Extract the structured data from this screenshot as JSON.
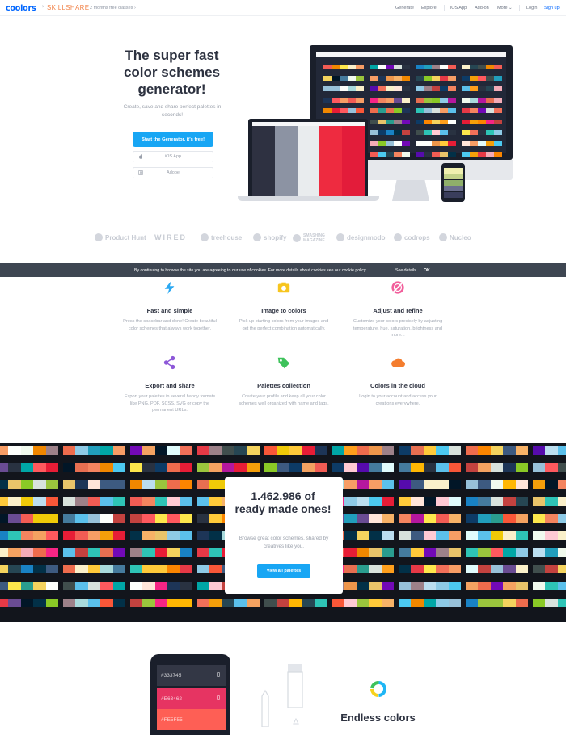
{
  "header": {
    "logo": "coolors",
    "partner_sep": "×",
    "partner": "SKILLSHARE",
    "promo": "2 months free classes ›",
    "nav": [
      "Generate",
      "Explore",
      "iOS App",
      "Add-on",
      "More ⌄",
      "Login",
      "Sign up"
    ]
  },
  "hero": {
    "title": "The super fast color schemes generator!",
    "subtitle": "Create, save and share perfect palettes in seconds!",
    "cta": "Start the Generator, it's free!",
    "ios": "iOS App",
    "adobe": "Adobe"
  },
  "brands": [
    "Product Hunt",
    "WIRED",
    "treehouse",
    "shopify",
    "SMASHING MAGAZINE",
    "designmodo",
    "codrops",
    "Nucleo"
  ],
  "cookie": {
    "text": "By continuing to browse the site you are agreeing to our use of cookies. For more details about cookies see our cookie policy.",
    "see": "See details",
    "ok": "OK"
  },
  "features": [
    {
      "title": "Fast and simple",
      "desc": "Press the spacebar and done! Create beautiful color schemes that always work together."
    },
    {
      "title": "Image to colors",
      "desc": "Pick up starting colors from your images and get the perfect combination automatically."
    },
    {
      "title": "Adjust and refine",
      "desc": "Customize your colors precisely by adjusting temperature, hue, saturation, brightness and more..."
    },
    {
      "title": "Export and share",
      "desc": "Export your palettes in several handy formats like PNG, PDF, SCSS, SVG or copy the permanent URLs."
    },
    {
      "title": "Palettes collection",
      "desc": "Create your profile and keep all your color schemes well organized with name and tags."
    },
    {
      "title": "Colors in the cloud",
      "desc": "Login to your account and access your creations everywhere."
    }
  ],
  "counter": {
    "number": "1.462.986 of ready made ones!",
    "subtitle": "Browse great color schemes, shared by creatives like you.",
    "button": "View all palettes"
  },
  "bottom_phone": [
    "#333745",
    "#E63462",
    "#FE5F55"
  ],
  "bottom_title": "Endless colors",
  "colors": {
    "accent": "#18A6F4",
    "brand": "#0066FF",
    "laptop_palette": [
      "#2E3141",
      "#8C93A3",
      "#E9ECEE",
      "#EE2B40",
      "#E31C3A"
    ],
    "phone_palette": [
      "#F0F0B0",
      "#C4D38A",
      "#8FAF6A",
      "#6B6F8E",
      "#3A3E5C"
    ]
  }
}
